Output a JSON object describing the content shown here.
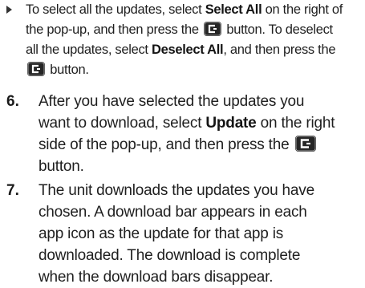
{
  "sub_bullet": {
    "line1_pre": "To select all the updates, select ",
    "select_all": "Select All",
    "line1_post": " on the right of",
    "line2_pre": "the pop-up, and then press the ",
    "line2_post": " button. To deselect",
    "line3_pre": "all the updates, select ",
    "deselect_all": "Deselect All",
    "line3_post": ", and then press the",
    "line4_post": " button."
  },
  "step6": {
    "number": "6.",
    "line1": "After you have selected the updates you",
    "line2": "want to download, select ",
    "update": "Update",
    "line2_post": " on the right",
    "line3_pre": "side of the pop-up, and then press the ",
    "line4": "button."
  },
  "step7": {
    "number": "7.",
    "lines": [
      "The unit downloads the updates you have",
      "chosen. A download bar appears in each",
      "app icon as the update for that app is",
      "downloaded. The download is complete",
      "when the download bars disappear."
    ]
  },
  "icons": {
    "enter": "enter-button-icon",
    "bullet": "triangle-bullet-icon"
  }
}
